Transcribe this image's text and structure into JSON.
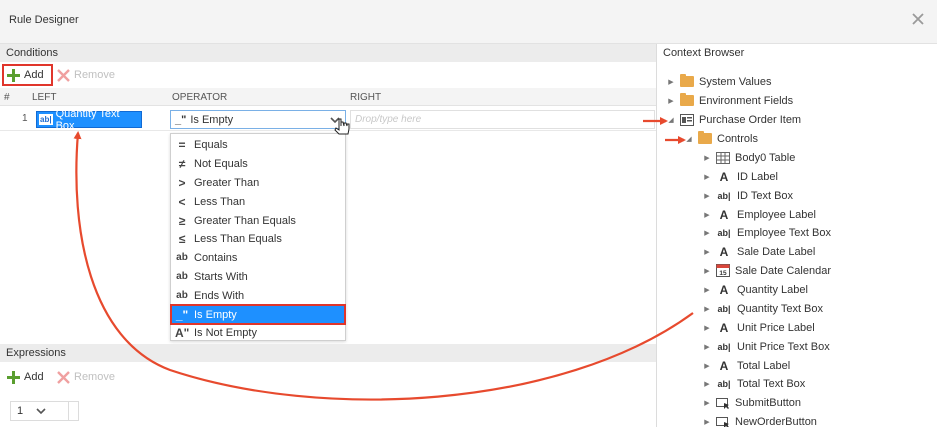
{
  "window": {
    "title": "Rule Designer"
  },
  "conditions": {
    "header": "Conditions",
    "add_label": "Add",
    "remove_label": "Remove",
    "columns": {
      "num": "#",
      "left": "LEFT",
      "operator": "OPERATOR",
      "right": "RIGHT"
    },
    "row": {
      "num": "1",
      "left_value": "Quantity Text Box",
      "operator_value": "Is Empty",
      "right_placeholder": "Drop/type here"
    },
    "operator_options": [
      {
        "label": "Equals",
        "icon": "equals-icon",
        "glyph": "="
      },
      {
        "label": "Not Equals",
        "icon": "not-equals-icon",
        "glyph": "≠"
      },
      {
        "label": "Greater Than",
        "icon": "greater-than-icon",
        "glyph": ">"
      },
      {
        "label": "Less Than",
        "icon": "less-than-icon",
        "glyph": "<"
      },
      {
        "label": "Greater Than Equals",
        "icon": "greater-than-equals-icon",
        "glyph": "≥"
      },
      {
        "label": "Less Than Equals",
        "icon": "less-than-equals-icon",
        "glyph": "≤"
      },
      {
        "label": "Contains",
        "icon": "contains-icon",
        "glyph": "ab"
      },
      {
        "label": "Starts With",
        "icon": "starts-with-icon",
        "glyph": "ab"
      },
      {
        "label": "Ends With",
        "icon": "ends-with-icon",
        "glyph": "ab"
      },
      {
        "label": "Is Empty",
        "icon": "is-empty-icon",
        "glyph": "_\"",
        "selected": true
      },
      {
        "label": "Is Not Empty",
        "icon": "is-not-empty-icon",
        "glyph": "A\""
      }
    ]
  },
  "expressions": {
    "header": "Expressions",
    "add_label": "Add",
    "remove_label": "Remove",
    "page_value": "1"
  },
  "context_browser": {
    "header": "Context Browser",
    "items": [
      {
        "label": "System Values",
        "icon": "folder-icon",
        "expand": "collapsed"
      },
      {
        "label": "Environment Fields",
        "icon": "folder-icon",
        "expand": "collapsed"
      },
      {
        "label": "Purchase Order Item",
        "icon": "form-icon",
        "expand": "expanded"
      },
      {
        "label": "Controls",
        "icon": "folder-icon",
        "expand": "expanded"
      },
      {
        "label": "Body0 Table",
        "icon": "table-icon",
        "expand": "collapsed"
      },
      {
        "label": "ID Label",
        "icon": "label-icon",
        "expand": "collapsed"
      },
      {
        "label": "ID Text Box",
        "icon": "textbox-icon",
        "expand": "collapsed"
      },
      {
        "label": "Employee Label",
        "icon": "label-icon",
        "expand": "collapsed"
      },
      {
        "label": "Employee Text Box",
        "icon": "textbox-icon",
        "expand": "collapsed"
      },
      {
        "label": "Sale Date Label",
        "icon": "label-icon",
        "expand": "collapsed"
      },
      {
        "label": "Sale Date Calendar",
        "icon": "calendar-icon",
        "expand": "collapsed"
      },
      {
        "label": "Quantity Label",
        "icon": "label-icon",
        "expand": "collapsed"
      },
      {
        "label": "Quantity Text Box",
        "icon": "textbox-icon",
        "expand": "collapsed"
      },
      {
        "label": "Unit Price Label",
        "icon": "label-icon",
        "expand": "collapsed"
      },
      {
        "label": "Unit Price Text Box",
        "icon": "textbox-icon",
        "expand": "collapsed"
      },
      {
        "label": "Total Label",
        "icon": "label-icon",
        "expand": "collapsed"
      },
      {
        "label": "Total Text Box",
        "icon": "textbox-icon",
        "expand": "collapsed"
      },
      {
        "label": "SubmitButton",
        "icon": "button-icon",
        "expand": "collapsed"
      },
      {
        "label": "NewOrderButton",
        "icon": "button-icon",
        "expand": "collapsed"
      }
    ]
  },
  "colors": {
    "accent_blue": "#1e90ff",
    "highlight_red": "#e0352b",
    "add_green": "#5a9e2f",
    "folder_orange": "#e9a94a"
  }
}
